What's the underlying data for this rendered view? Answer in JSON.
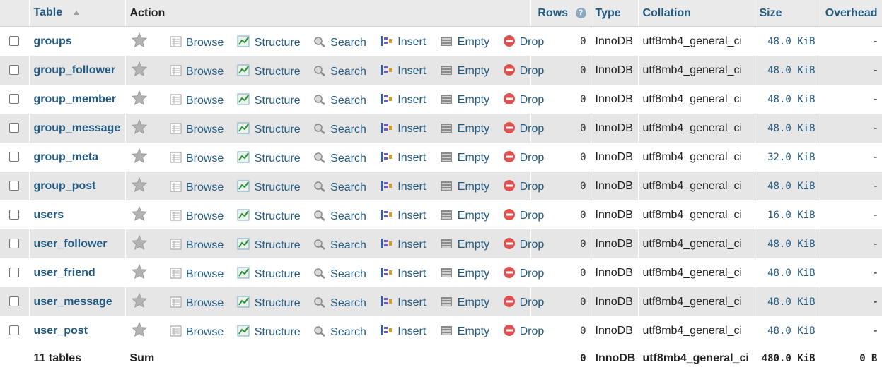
{
  "header": {
    "table": "Table",
    "action": "Action",
    "rows": "Rows",
    "type": "Type",
    "collation": "Collation",
    "size": "Size",
    "overhead": "Overhead"
  },
  "actions": {
    "browse": "Browse",
    "structure": "Structure",
    "search": "Search",
    "insert": "Insert",
    "empty": "Empty",
    "drop": "Drop"
  },
  "tables": [
    {
      "name": "groups",
      "rows": "0",
      "type": "InnoDB",
      "collation": "utf8mb4_general_ci",
      "size": "48.0 KiB",
      "overhead": "-"
    },
    {
      "name": "group_follower",
      "rows": "0",
      "type": "InnoDB",
      "collation": "utf8mb4_general_ci",
      "size": "48.0 KiB",
      "overhead": "-"
    },
    {
      "name": "group_member",
      "rows": "0",
      "type": "InnoDB",
      "collation": "utf8mb4_general_ci",
      "size": "48.0 KiB",
      "overhead": "-"
    },
    {
      "name": "group_message",
      "rows": "0",
      "type": "InnoDB",
      "collation": "utf8mb4_general_ci",
      "size": "48.0 KiB",
      "overhead": "-"
    },
    {
      "name": "group_meta",
      "rows": "0",
      "type": "InnoDB",
      "collation": "utf8mb4_general_ci",
      "size": "32.0 KiB",
      "overhead": "-"
    },
    {
      "name": "group_post",
      "rows": "0",
      "type": "InnoDB",
      "collation": "utf8mb4_general_ci",
      "size": "48.0 KiB",
      "overhead": "-"
    },
    {
      "name": "users",
      "rows": "0",
      "type": "InnoDB",
      "collation": "utf8mb4_general_ci",
      "size": "16.0 KiB",
      "overhead": "-"
    },
    {
      "name": "user_follower",
      "rows": "0",
      "type": "InnoDB",
      "collation": "utf8mb4_general_ci",
      "size": "48.0 KiB",
      "overhead": "-"
    },
    {
      "name": "user_friend",
      "rows": "0",
      "type": "InnoDB",
      "collation": "utf8mb4_general_ci",
      "size": "48.0 KiB",
      "overhead": "-"
    },
    {
      "name": "user_message",
      "rows": "0",
      "type": "InnoDB",
      "collation": "utf8mb4_general_ci",
      "size": "48.0 KiB",
      "overhead": "-"
    },
    {
      "name": "user_post",
      "rows": "0",
      "type": "InnoDB",
      "collation": "utf8mb4_general_ci",
      "size": "48.0 KiB",
      "overhead": "-"
    }
  ],
  "footer": {
    "count": "11 tables",
    "sum": "Sum",
    "rows": "0",
    "type": "InnoDB",
    "collation": "utf8mb4_general_ci",
    "size": "480.0 KiB",
    "overhead": "0 B"
  },
  "icons": {
    "favorite": "star-icon",
    "browse": "browse-icon",
    "structure": "structure-icon",
    "search": "search-icon",
    "insert": "insert-icon",
    "empty": "empty-icon",
    "drop": "drop-icon",
    "sort": "sort-asc-icon",
    "help": "help-icon"
  },
  "colors": {
    "link": "#235a81",
    "header_bg": "#eaeaea",
    "row_alt_bg": "#e6e6e6",
    "drop": "#e05050",
    "star": "#a8a8a8"
  }
}
